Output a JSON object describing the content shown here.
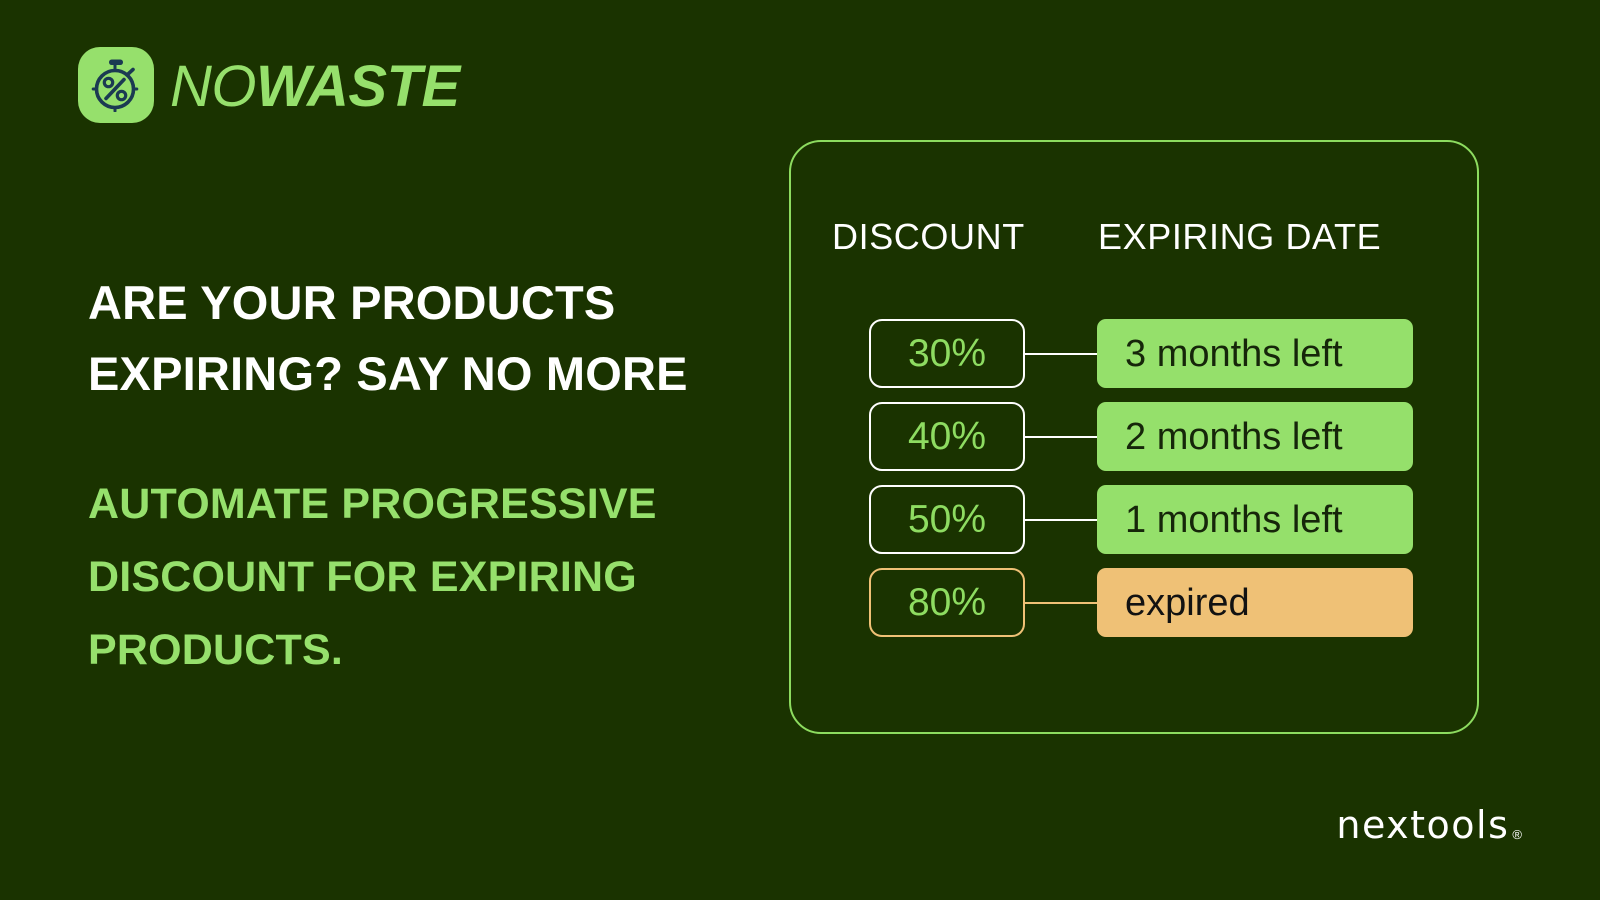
{
  "brand": {
    "icon_name": "stopwatch-percent-icon",
    "name_light": "NO",
    "name_bold": "WASTE",
    "mark_bg": "#96e06c",
    "mark_fg": "#1b3a52"
  },
  "hero": {
    "headline": "ARE YOUR PRODUCTS EXPIRING? SAY NO MORE",
    "subheadline": "AUTOMATE PROGRESSIVE DISCOUNT FOR EXPIRING PRODUCTS."
  },
  "card": {
    "columns": {
      "discount": "DISCOUNT",
      "expiring_date": "EXPIRING DATE"
    },
    "rows": [
      {
        "discount": "30%",
        "expiring": "3 months left",
        "state": "ok"
      },
      {
        "discount": "40%",
        "expiring": "2 months left",
        "state": "ok"
      },
      {
        "discount": "50%",
        "expiring": "1 months left",
        "state": "ok"
      },
      {
        "discount": "80%",
        "expiring": "expired",
        "state": "warn"
      }
    ]
  },
  "footer": {
    "wordmark": "nextools",
    "registered": "®"
  },
  "colors": {
    "background": "#1a3300",
    "accent_green": "#96e06c",
    "pill_green": "#95e06b",
    "pill_orange": "#efc176",
    "white": "#ffffff",
    "card_border": "#8ddc5f",
    "pill_text_dark": "#16260a"
  }
}
